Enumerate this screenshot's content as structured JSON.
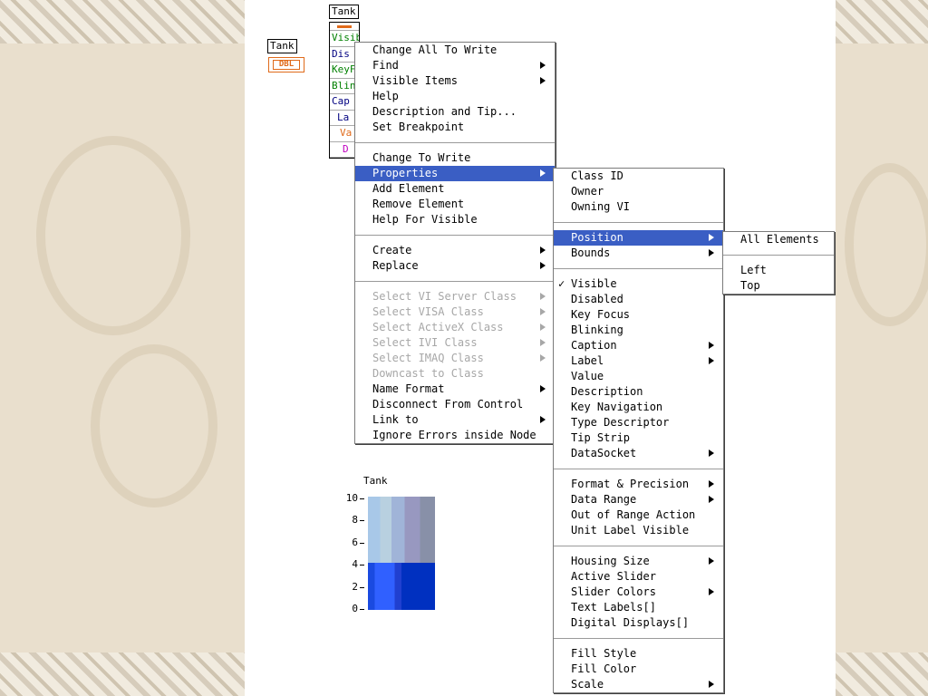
{
  "icons": {
    "tank_label": "Tank",
    "dbl": "DBL",
    "node_label": "Tank"
  },
  "property_node": {
    "rows": [
      "Visible",
      "Dis",
      "KeyF",
      "Blin",
      "Cap",
      "La",
      "Va",
      "D"
    ]
  },
  "main_menu": {
    "items": [
      {
        "label": "Change All To Write"
      },
      {
        "label": "Find",
        "sub": true
      },
      {
        "label": "Visible Items",
        "sub": true
      },
      {
        "label": "Help"
      },
      {
        "label": "Description and Tip..."
      },
      {
        "label": "Set Breakpoint"
      },
      {
        "sep": true
      },
      {
        "label": "Change To Write"
      },
      {
        "label": "Properties",
        "sub": true,
        "selected": true
      },
      {
        "label": "Add Element"
      },
      {
        "label": "Remove Element"
      },
      {
        "label": "Help For Visible"
      },
      {
        "sep": true
      },
      {
        "label": "Create",
        "sub": true
      },
      {
        "label": "Replace",
        "sub": true
      },
      {
        "sep": true
      },
      {
        "label": "Select VI Server Class",
        "sub": true,
        "disabled": true
      },
      {
        "label": "Select VISA Class",
        "sub": true,
        "disabled": true
      },
      {
        "label": "Select ActiveX Class",
        "sub": true,
        "disabled": true
      },
      {
        "label": "Select IVI Class",
        "sub": true,
        "disabled": true
      },
      {
        "label": "Select IMAQ Class",
        "sub": true,
        "disabled": true
      },
      {
        "label": "Downcast to Class",
        "disabled": true
      },
      {
        "label": "Name Format",
        "sub": true
      },
      {
        "label": "Disconnect From Control"
      },
      {
        "label": "Link to",
        "sub": true
      },
      {
        "label": "Ignore Errors inside Node"
      }
    ]
  },
  "properties_menu": {
    "items": [
      {
        "label": "Class ID"
      },
      {
        "label": "Owner"
      },
      {
        "label": "Owning VI"
      },
      {
        "sep": true
      },
      {
        "label": "Position",
        "sub": true,
        "selected": true
      },
      {
        "label": "Bounds",
        "sub": true
      },
      {
        "sep": true
      },
      {
        "label": "Visible",
        "checked": true
      },
      {
        "label": "Disabled"
      },
      {
        "label": "Key Focus"
      },
      {
        "label": "Blinking"
      },
      {
        "label": "Caption",
        "sub": true
      },
      {
        "label": "Label",
        "sub": true
      },
      {
        "label": "Value"
      },
      {
        "label": "Description"
      },
      {
        "label": "Key Navigation"
      },
      {
        "label": "Type Descriptor"
      },
      {
        "label": "Tip Strip"
      },
      {
        "label": "DataSocket",
        "sub": true
      },
      {
        "sep": true
      },
      {
        "label": "Format & Precision",
        "sub": true
      },
      {
        "label": "Data Range",
        "sub": true
      },
      {
        "label": "Out of Range Action"
      },
      {
        "label": "Unit Label Visible"
      },
      {
        "sep": true
      },
      {
        "label": "Housing Size",
        "sub": true
      },
      {
        "label": "Active Slider"
      },
      {
        "label": "Slider Colors",
        "sub": true
      },
      {
        "label": "Text Labels[]"
      },
      {
        "label": "Digital Displays[]"
      },
      {
        "sep": true
      },
      {
        "label": "Fill Style"
      },
      {
        "label": "Fill Color"
      },
      {
        "label": "Scale",
        "sub": true
      }
    ]
  },
  "position_menu": {
    "items": [
      {
        "label": "All Elements"
      },
      {
        "sep": true
      },
      {
        "label": "Left"
      },
      {
        "label": "Top"
      }
    ]
  },
  "tank": {
    "title": "Tank",
    "ticks": [
      "10",
      "8",
      "6",
      "4",
      "2",
      "0"
    ],
    "value": 4.2,
    "max": 10
  },
  "check_mark": "✓"
}
